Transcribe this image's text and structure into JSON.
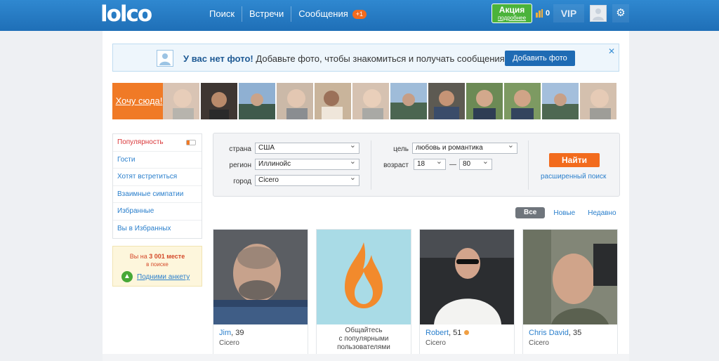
{
  "header": {
    "logo": "lolco",
    "nav": [
      {
        "label": "Поиск"
      },
      {
        "label": "Встречи"
      },
      {
        "label": "Сообщения",
        "badge": "+1"
      }
    ],
    "promo": {
      "title": "Акция",
      "subtitle": "подробнее"
    },
    "coins": "0",
    "vip": "VIP",
    "settings_icon": "gear-icon"
  },
  "notice": {
    "bold": "У вас нет фото!",
    "text": " Добавьте фото, чтобы знакомиться и получать сообщения",
    "button": "Добавить фото",
    "close": "✕"
  },
  "strip": {
    "cta": "Хочу сюда!"
  },
  "sidebar": {
    "items": [
      {
        "label": "Популярность"
      },
      {
        "label": "Гости"
      },
      {
        "label": "Хотят встретиться"
      },
      {
        "label": "Взаимные симпатии"
      },
      {
        "label": "Избранные"
      },
      {
        "label": "Вы в Избранных"
      }
    ],
    "rank": {
      "prefix": "Вы на ",
      "place": "3 001 месте",
      "suffix": "в поиске",
      "link": "Подними анкету"
    }
  },
  "search": {
    "country_label": "страна",
    "country_value": "США",
    "region_label": "регион",
    "region_value": "Иллинойс",
    "city_label": "город",
    "city_value": "Cicero",
    "goal_label": "цель",
    "goal_value": "любовь и романтика",
    "age_label": "возраст",
    "age_from": "18",
    "age_to": "80",
    "age_dash": "—",
    "find_button": "Найти",
    "advanced_link": "расширенный поиск"
  },
  "filters": {
    "tabs": [
      "Все",
      "Новые",
      "Недавно"
    ]
  },
  "cards": [
    {
      "name": "Jim",
      "age": ", 39",
      "city": "Cicero"
    },
    {
      "promo_text_1": "Общайтесь",
      "promo_text_2": "с популярными",
      "promo_text_3": "пользователями"
    },
    {
      "name": "Robert",
      "age": ", 51",
      "city": "Cicero"
    },
    {
      "name": "Chris David",
      "age": ", 35",
      "city": "Cicero"
    }
  ],
  "colors": {
    "header_blue": "#1f6fb7",
    "accent_orange": "#f26b1d",
    "link_blue": "#2a7fcc",
    "promo_green": "#4bb33b"
  }
}
